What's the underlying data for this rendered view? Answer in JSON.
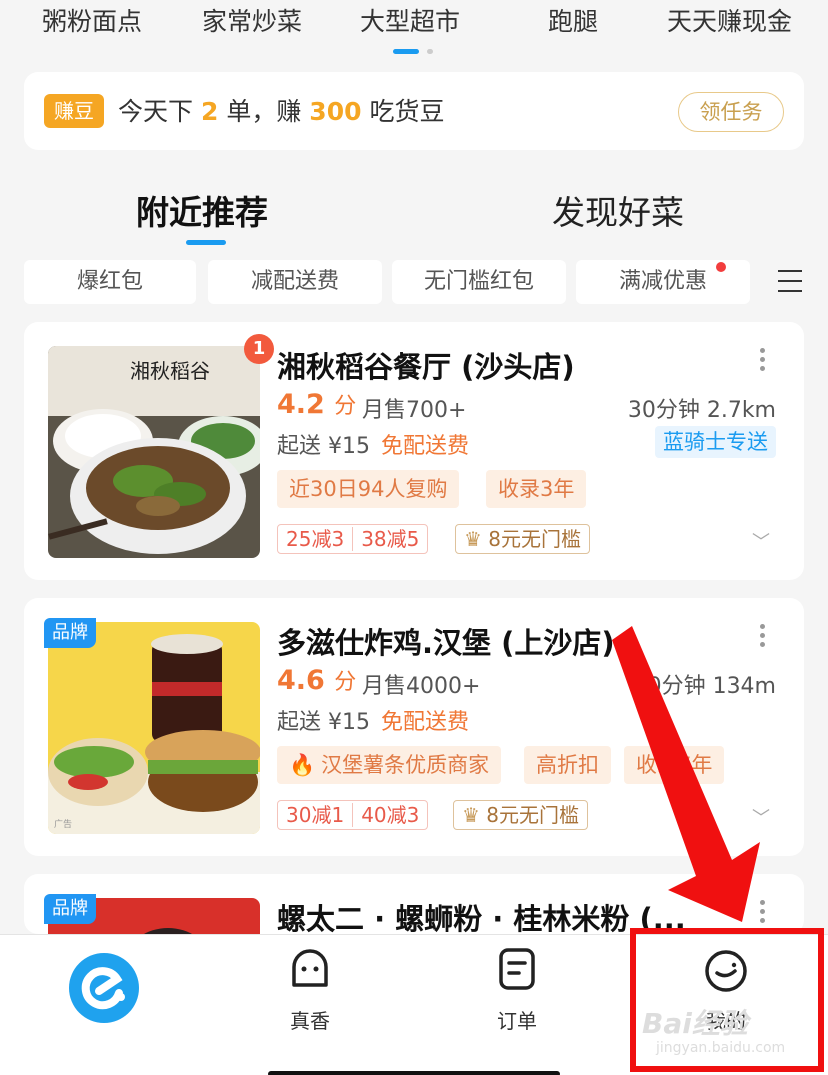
{
  "categories": [
    "粥粉面点",
    "家常炒菜",
    "大型超市",
    "跑腿",
    "天天赚现金"
  ],
  "task": {
    "badge": "赚豆",
    "text_prefix": "今天下",
    "orders": "2",
    "text_mid": "单，赚",
    "beans": "300",
    "text_suffix": "吃货豆",
    "button": "领任务"
  },
  "tabs": [
    "附近推荐",
    "发现好菜"
  ],
  "filters": [
    "爆红包",
    "减配送费",
    "无门槛红包",
    "满减优惠"
  ],
  "stores": [
    {
      "badge_count": "1",
      "name": "湘秋稻谷餐厅 (沙头店)",
      "score": "4.2",
      "score_unit": "分",
      "sales": "月售700+",
      "distance": "30分钟 2.7km",
      "min_order": "起送 ¥15",
      "delivery": "免配送费",
      "rider": "蓝骑士专送",
      "tags": [
        "近30日94人复购",
        "收录3年"
      ],
      "discounts": [
        "25减3",
        "38减5"
      ],
      "coupon": "8元无门槛",
      "thumb_text": "湘秋稻谷"
    },
    {
      "brand": "品牌",
      "name": "多滋仕炸鸡.汉堡 (上沙店)",
      "score": "4.6",
      "score_unit": "分",
      "sales": "月售4000+",
      "distance": "30分钟 134m",
      "min_order": "起送 ¥15",
      "delivery": "免配送费",
      "tags": [
        "汉堡薯条优质商家",
        "高折扣",
        "收录7年"
      ],
      "discounts": [
        "30减1",
        "40减3"
      ],
      "coupon": "8元无门槛",
      "ad": "广告"
    },
    {
      "brand": "品牌",
      "name": "螺太二 · 螺蛳粉 · 桂林米粉 (..."
    }
  ],
  "tabbar": {
    "items": [
      {
        "label": "",
        "icon": "eleme-logo-icon"
      },
      {
        "label": "真香",
        "icon": "smile-face-icon"
      },
      {
        "label": "订单",
        "icon": "order-doc-icon"
      },
      {
        "label": "我的",
        "icon": "profile-face-icon"
      }
    ]
  },
  "watermark": {
    "main": "Bai经验",
    "sub": "jingyan.baidu.com"
  },
  "colors": {
    "accent": "#1a9bf0",
    "orange": "#f07735",
    "highlight": "#f01010"
  }
}
